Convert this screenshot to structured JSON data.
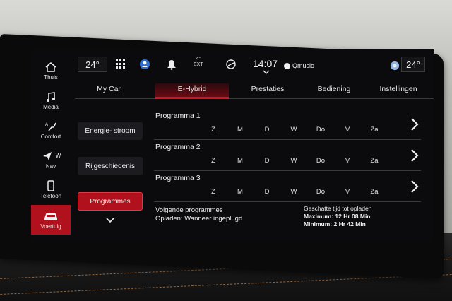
{
  "sidebar": {
    "items": [
      {
        "label": "Thuis",
        "icon": "home-icon"
      },
      {
        "label": "Media",
        "icon": "music-note-icon"
      },
      {
        "label": "Comfort",
        "icon": "seat-comfort-icon"
      },
      {
        "label": "Nav",
        "icon": "navigation-arrow-icon",
        "extra": "W"
      },
      {
        "label": "Telefoon",
        "icon": "phone-icon"
      },
      {
        "label": "Voertuig",
        "icon": "car-icon",
        "active": true
      }
    ]
  },
  "topbar": {
    "temp_left": "24°",
    "ext_temp": "4°",
    "ext_label": "EXT",
    "time": "14:07",
    "media": "Qmusic",
    "temp_right": "24°"
  },
  "tabs": [
    {
      "label": "My Car"
    },
    {
      "label": "E-Hybrid",
      "active": true
    },
    {
      "label": "Prestaties"
    },
    {
      "label": "Bediening"
    },
    {
      "label": "Instellingen"
    }
  ],
  "menu": [
    {
      "label": "Energie- stroom"
    },
    {
      "label": "Rijgeschiedenis"
    },
    {
      "label": "Programmes",
      "active": true
    }
  ],
  "programs": [
    {
      "title": "Programma 1"
    },
    {
      "title": "Programma 2"
    },
    {
      "title": "Programma 3"
    }
  ],
  "days": [
    "Z",
    "M",
    "D",
    "W",
    "Do",
    "V",
    "Za"
  ],
  "footer": {
    "next_title": "Volgende programmes",
    "next_value": "Opladen: Wanneer ingeplugd",
    "est_title": "Geschatte tijd tot opladen",
    "max_label": "Maximum:",
    "max_value": "12 Hr 08 Min",
    "min_label": "Minimum:",
    "min_value": "2 Hr 42 Min"
  },
  "colors": {
    "accent": "#b0111c",
    "screen_bg": "#0b0b0d"
  }
}
